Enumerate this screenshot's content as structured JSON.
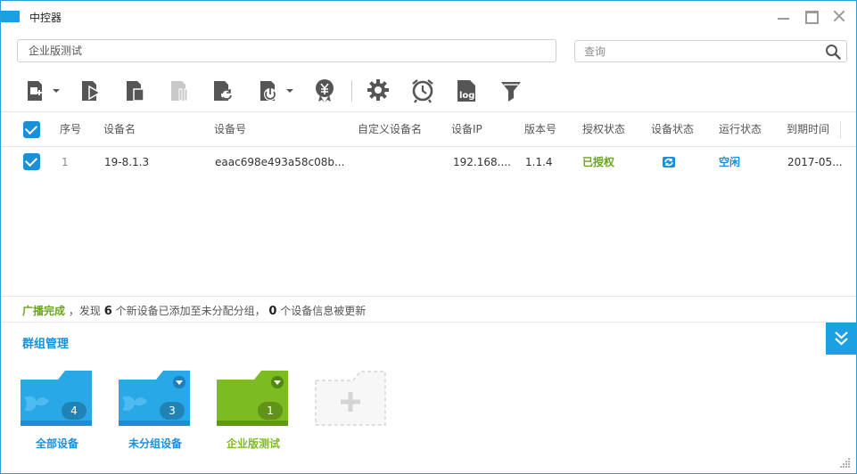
{
  "window": {
    "title": "中控器"
  },
  "group_select": {
    "value": "企业版测试"
  },
  "search": {
    "placeholder": "查询"
  },
  "toolbar": {
    "buttons": [
      {
        "name": "add-device",
        "icon": "add-device-icon",
        "has_dropdown": true
      },
      {
        "name": "start",
        "icon": "play-device-icon"
      },
      {
        "name": "stop",
        "icon": "stop-device-icon"
      },
      {
        "name": "pause",
        "icon": "pause-device-icon",
        "disabled": true
      },
      {
        "name": "refresh",
        "icon": "refresh-device-icon"
      },
      {
        "name": "power",
        "icon": "power-icon",
        "has_dropdown": true
      },
      {
        "name": "license",
        "icon": "license-badge-icon"
      },
      {
        "name": "settings",
        "icon": "gear-icon"
      },
      {
        "name": "alarm",
        "icon": "alarm-clock-icon"
      },
      {
        "name": "log",
        "icon": "log-icon"
      },
      {
        "name": "filter",
        "icon": "filter-icon"
      }
    ]
  },
  "table": {
    "headers": {
      "index": "序号",
      "device_name": "设备名",
      "device_id": "设备号",
      "custom_name": "自定义设备名",
      "device_ip": "设备IP",
      "version": "版本号",
      "auth_status": "授权状态",
      "device_status": "设备状态",
      "run_status": "运行状态",
      "expire": "到期时间"
    },
    "rows": [
      {
        "index": "1",
        "device_name": "19-8.1.3",
        "device_id": "eaac698e493a58c08b...",
        "custom_name": "",
        "device_ip": "192.168....",
        "version": "1.1.4",
        "auth_status": "已授权",
        "device_status_icon": "sync-status-icon",
        "run_status": "空闲",
        "expire": "2017-05..."
      }
    ]
  },
  "status": {
    "prefix": "广播完成",
    "text1": "，发现",
    "new_count": "6",
    "text2": "个新设备已添加至未分配分组，",
    "updated_count": "0",
    "text3": "个设备信息被更新"
  },
  "groups": {
    "title": "群组管理",
    "items": [
      {
        "label": "全部设备",
        "count": "4",
        "color": "#29a8e8"
      },
      {
        "label": "未分组设备",
        "count": "3",
        "color": "#29a8e8"
      },
      {
        "label": "企业版测试",
        "count": "1",
        "color": "#7dbb22"
      }
    ]
  },
  "colors": {
    "accent": "#1ba1e2",
    "green": "#7dbb22"
  }
}
